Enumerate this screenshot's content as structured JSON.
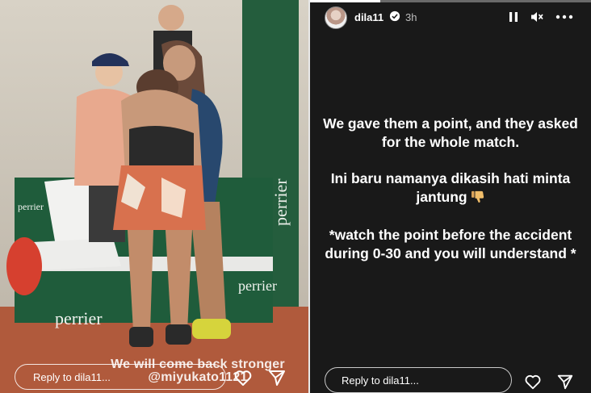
{
  "left_story": {
    "overlay_text": "We will come back stronger @miyukato1121",
    "reply_placeholder": "Reply to dila11...",
    "icons": {
      "like": "heart-outline-icon",
      "share": "send-icon"
    }
  },
  "right_story": {
    "username": "dila11",
    "time_ago": "3h",
    "verified": true,
    "progress": 0.25,
    "caption_1": "We gave them a point, and they asked for the whole match.",
    "caption_2": "Ini baru namanya dikasih hati minta jantung",
    "caption_2_emoji": "thumbs-down-emoji",
    "caption_3": "*watch the point before the accident during 0-30 and you will understand *",
    "reply_placeholder": "Reply to dila11...",
    "icons": {
      "pause": "pause-icon",
      "mute": "mute-icon",
      "more": "more-icon",
      "like": "heart-outline-icon",
      "share": "send-icon"
    }
  },
  "photo_signage": {
    "sign": "perrier"
  },
  "colors": {
    "story_bg": "#191919",
    "text": "#ffffff",
    "court_clay": "#b05a3c",
    "court_green": "#1f5c3b"
  }
}
